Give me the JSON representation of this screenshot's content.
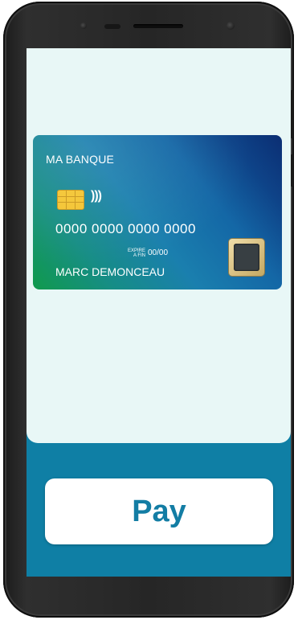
{
  "card": {
    "bank_name": "MA BANQUE",
    "number": "0000 0000 0000 0000",
    "expiry_label_line1": "EXPIRE",
    "expiry_label_line2": "A FIN",
    "expiry": "00/00",
    "holder": "MARC DEMONCEAU",
    "contactless_symbol": ")))"
  },
  "actions": {
    "pay_label": "Pay"
  },
  "icons": {
    "chip": "card-chip-icon",
    "contactless": "contactless-icon",
    "fingerprint": "fingerprint-sensor-icon"
  },
  "colors": {
    "screen_bg": "#0f7fa5",
    "panel_bg": "#e8f7f6",
    "pay_text": "#137da4",
    "chip": "#f4c430"
  }
}
